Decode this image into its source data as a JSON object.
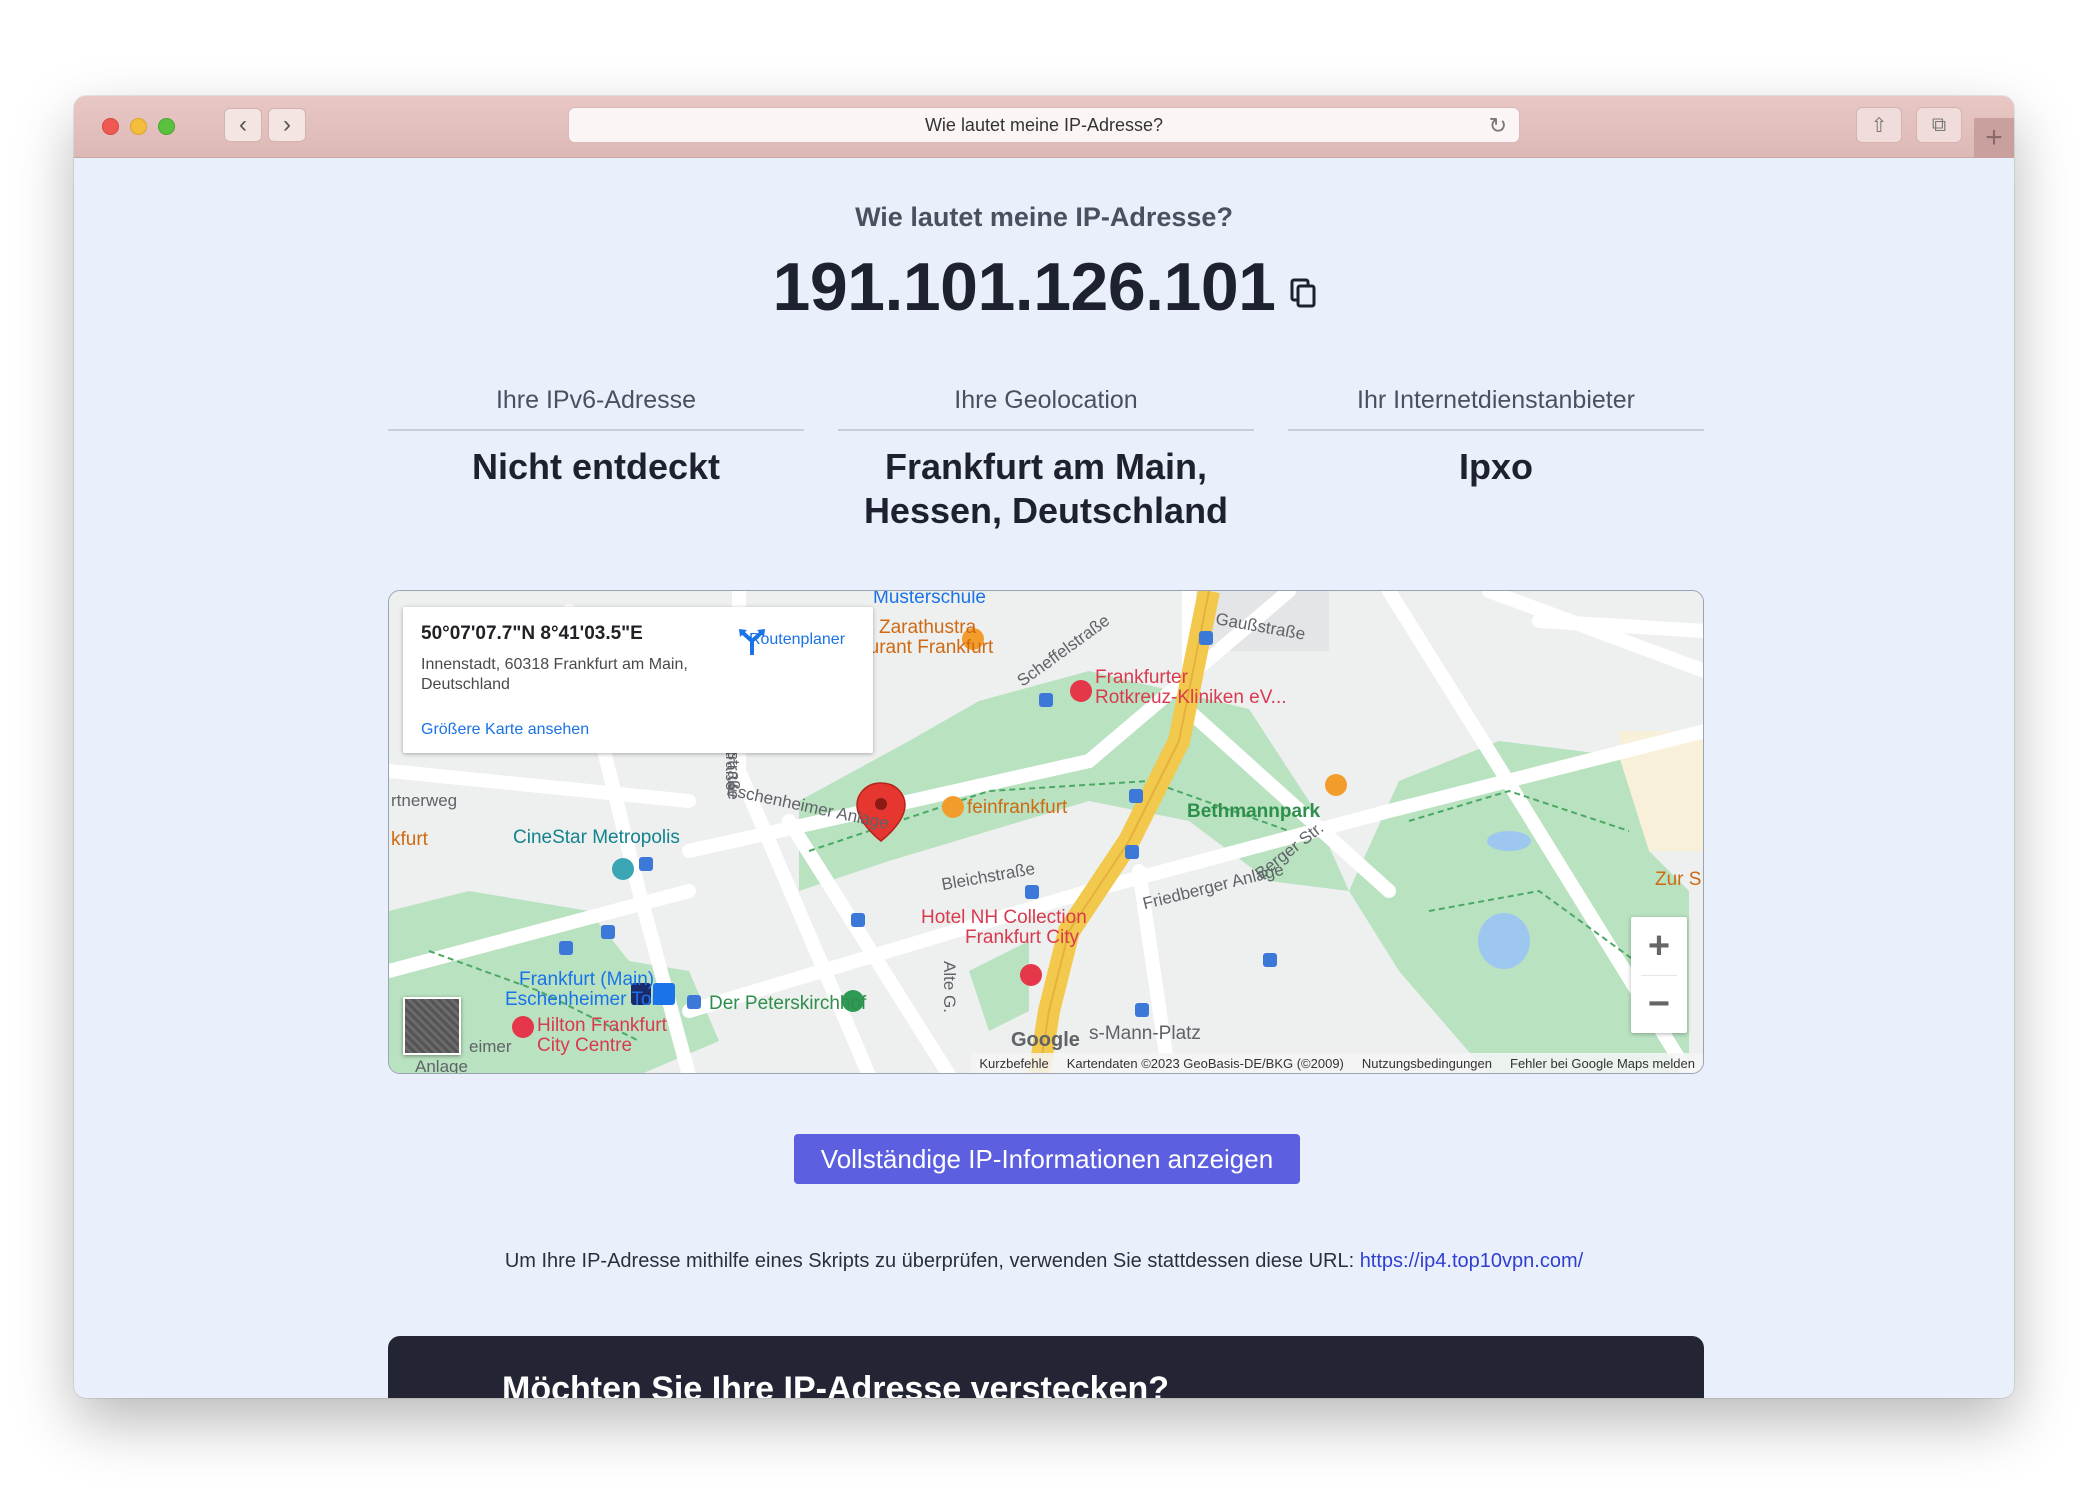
{
  "browser": {
    "tab_title": "Wie lautet meine IP-Adresse?",
    "back_icon": "‹",
    "forward_icon": "›"
  },
  "page": {
    "heading": "Wie lautet meine IP-Adresse?",
    "ip_address": "191.101.126.101",
    "info": [
      {
        "label": "Ihre IPv6-Adresse",
        "value": "Nicht entdeckt"
      },
      {
        "label": "Ihre Geolocation",
        "value_line1": "Frankfurt am Main,",
        "value_line2": "Hessen, Deutschland"
      },
      {
        "label": "Ihr Internetdienstanbieter",
        "value": "Ipxo"
      }
    ],
    "full_info_button": "Vollständige IP-Informationen anzeigen",
    "script_note": "Um Ihre IP-Adresse mithilfe eines Skripts zu überprüfen, verwenden Sie stattdessen diese URL: ",
    "script_url": "https://ip4.top10vpn.com/",
    "banner_title": "Möchten Sie Ihre IP-Adresse verstecken?"
  },
  "map": {
    "card_coords": "50°07'07.7\"N 8°41'03.5\"E",
    "card_address": "Innenstadt, 60318 Frankfurt am Main, Deutschland",
    "card_route": "Routenplaner",
    "card_larger_map": "Größere Karte ansehen",
    "zoom_in": "+",
    "zoom_out": "−",
    "google_logo": "Google",
    "attrib_shortcuts": "Kurzbefehle",
    "attrib_data": "Kartendaten ©2023 GeoBasis-DE/BKG (©2009)",
    "attrib_terms": "Nutzungsbedingungen",
    "attrib_report": "Fehler bei Google Maps melden",
    "labels": {
      "musterschule": "Musterschule",
      "zarathustra_1": "Zarathustra",
      "zarathustra_2": "Restaurant Frankfurt",
      "rotkreuz_1": "Frankfurter",
      "rotkreuz_2": "Rotkreuz-Kliniken eV...",
      "cinestar": "CineStar Metropolis",
      "feinfrankfurt": "feinfrankfurt",
      "bethmannpark": "Bethmannpark",
      "hotel_nh_1": "Hotel NH Collection",
      "hotel_nh_2": "Frankfurt City",
      "frankfurt_main_1": "Frankfurt (Main)",
      "frankfurt_main_2": "Eschenheimer Tor",
      "hilton_1": "Hilton Frankfurt",
      "hilton_2": "City Centre",
      "peterskirchhof": "Der Peterskirchhof",
      "mann_platz": "s-Mann-Platz",
      "eschenheimer_anlage": "Eschenheimer Anlage",
      "bleichstrasse": "Bleichstraße",
      "friedberger_anlage": "Friedberger Anlage",
      "berger_str": "Berger Str.",
      "gaussstrasse": "Gaußstraße",
      "scheffelstrasse": "Scheffelstraße",
      "sternstrasse": "Sternstraße",
      "alte_g": "Alte G.",
      "kfurt": "kfurt",
      "rtnerweg": "rtnerweg",
      "zur_s": "Zur S",
      "eimer": "eimer",
      "anlage": "Anlage",
      "strasse": "traße"
    }
  }
}
